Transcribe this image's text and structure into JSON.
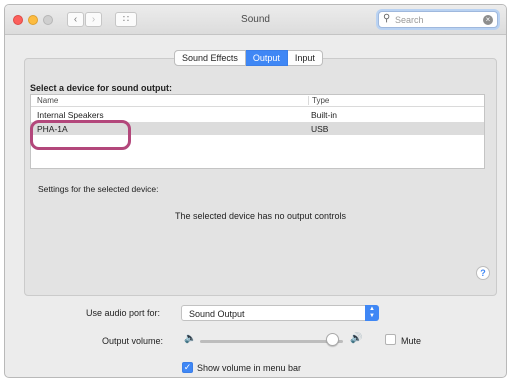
{
  "window": {
    "title": "Sound",
    "back_icon": "chevron-left",
    "forward_icon": "chevron-right",
    "grid_icon": "grid"
  },
  "search": {
    "placeholder": "Search",
    "icon": "magnifier"
  },
  "tabs": [
    {
      "label": "Sound Effects",
      "active": false
    },
    {
      "label": "Output",
      "active": true
    },
    {
      "label": "Input",
      "active": false
    }
  ],
  "output": {
    "select_title": "Select a device for sound output:",
    "columns": {
      "name": "Name",
      "type": "Type"
    },
    "devices": [
      {
        "name": "Internal Speakers",
        "type": "Built-in"
      },
      {
        "name": "PHA-1A",
        "type": "USB",
        "selected": true
      }
    ],
    "settings_label": "Settings for the selected device:",
    "no_controls": "The selected device has no output controls",
    "help": "?"
  },
  "audio_port": {
    "label": "Use audio port for:",
    "value": "Sound Output"
  },
  "volume": {
    "label": "Output volume:",
    "level": 0.93,
    "mute_label": "Mute",
    "muted": false
  },
  "menu_bar": {
    "label": "Show volume in menu bar",
    "checked": true
  },
  "colors": {
    "accent": "#3f87f5",
    "callout": "#b3477b"
  }
}
